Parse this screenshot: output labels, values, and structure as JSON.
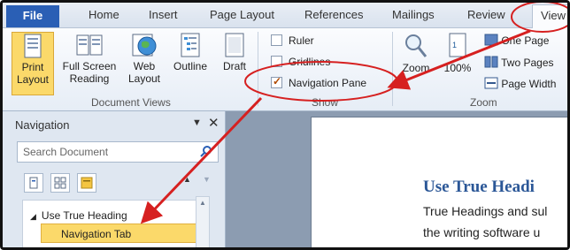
{
  "tabs": {
    "file": "File",
    "items": [
      "Home",
      "Insert",
      "Page Layout",
      "References",
      "Mailings",
      "Review"
    ],
    "view": "View"
  },
  "ribbon": {
    "document_views": {
      "label": "Document Views",
      "print_layout": [
        "Print",
        "Layout"
      ],
      "full_screen": [
        "Full Screen",
        "Reading"
      ],
      "web_layout": [
        "Web",
        "Layout"
      ],
      "outline": "Outline",
      "draft": "Draft"
    },
    "show": {
      "label": "Show",
      "ruler": "Ruler",
      "gridlines": "Gridlines",
      "navigation_pane": "Navigation Pane",
      "ruler_checked": false,
      "gridlines_checked": false,
      "navigation_pane_checked": true
    },
    "zoom": {
      "label": "Zoom",
      "zoom": "Zoom",
      "percent": "100%",
      "one_page": "One Page",
      "two_pages": "Two Pages",
      "page_width": "Page Width"
    }
  },
  "navigation": {
    "title": "Navigation",
    "search_placeholder": "Search Document",
    "heading": "Use True Heading",
    "selected_item": "Navigation Tab"
  },
  "document": {
    "heading": "Use True Headi",
    "line1": "True Headings and sul",
    "line2": "the writing software u"
  },
  "colors": {
    "file_tab": "#2a5fb5",
    "highlight": "#fbd96a",
    "annotation": "#d62020",
    "doc_heading": "#2b5797"
  }
}
